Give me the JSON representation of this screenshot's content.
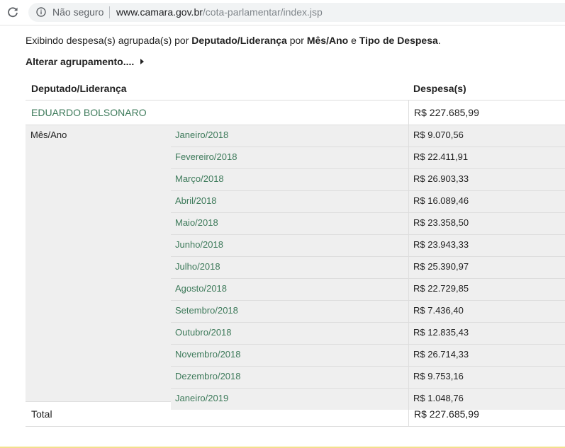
{
  "browser": {
    "security_label": "Não seguro",
    "url_host": "www.camara.gov.br",
    "url_path": "/cota-parlamentar/index.jsp"
  },
  "summary": {
    "prefix": "Exibindo despesa(s) agrupada(s) por ",
    "group1": "Deputado/Liderança",
    "middle1": " por ",
    "group2": "Mês/Ano",
    "middle2": " e ",
    "group3": "Tipo de Despesa",
    "suffix": "."
  },
  "alter_link": "Alterar agrupamento....",
  "table": {
    "header_deputado": "Deputado/Liderança",
    "header_despesa": "Despesa(s)",
    "deputado_name": "EDUARDO BOLSONARO",
    "deputado_total": "R$ 227.685,99",
    "group_label": "Mês/Ano",
    "months": [
      {
        "month": "Janeiro/2018",
        "value": "R$ 9.070,56"
      },
      {
        "month": "Fevereiro/2018",
        "value": "R$ 22.411,91"
      },
      {
        "month": "Março/2018",
        "value": "R$ 26.903,33"
      },
      {
        "month": "Abril/2018",
        "value": "R$ 16.089,46"
      },
      {
        "month": "Maio/2018",
        "value": "R$ 23.358,50"
      },
      {
        "month": "Junho/2018",
        "value": "R$ 23.943,33"
      },
      {
        "month": "Julho/2018",
        "value": "R$ 25.390,97"
      },
      {
        "month": "Agosto/2018",
        "value": "R$ 22.729,85"
      },
      {
        "month": "Setembro/2018",
        "value": "R$ 7.436,40"
      },
      {
        "month": "Outubro/2018",
        "value": "R$ 12.835,43"
      },
      {
        "month": "Novembro/2018",
        "value": "R$ 26.714,33"
      },
      {
        "month": "Dezembro/2018",
        "value": "R$ 9.753,16"
      },
      {
        "month": "Janeiro/2019",
        "value": "R$ 1.048,76"
      }
    ],
    "total_label": "Total",
    "total_value": "R$ 227.685,99"
  },
  "colors": {
    "link_green": "#3d7a5a",
    "group_bg": "#efefef",
    "border": "#dddddd"
  },
  "icons": {
    "reload": "reload-icon",
    "info": "info-icon",
    "expand": "triangle-right-icon"
  }
}
